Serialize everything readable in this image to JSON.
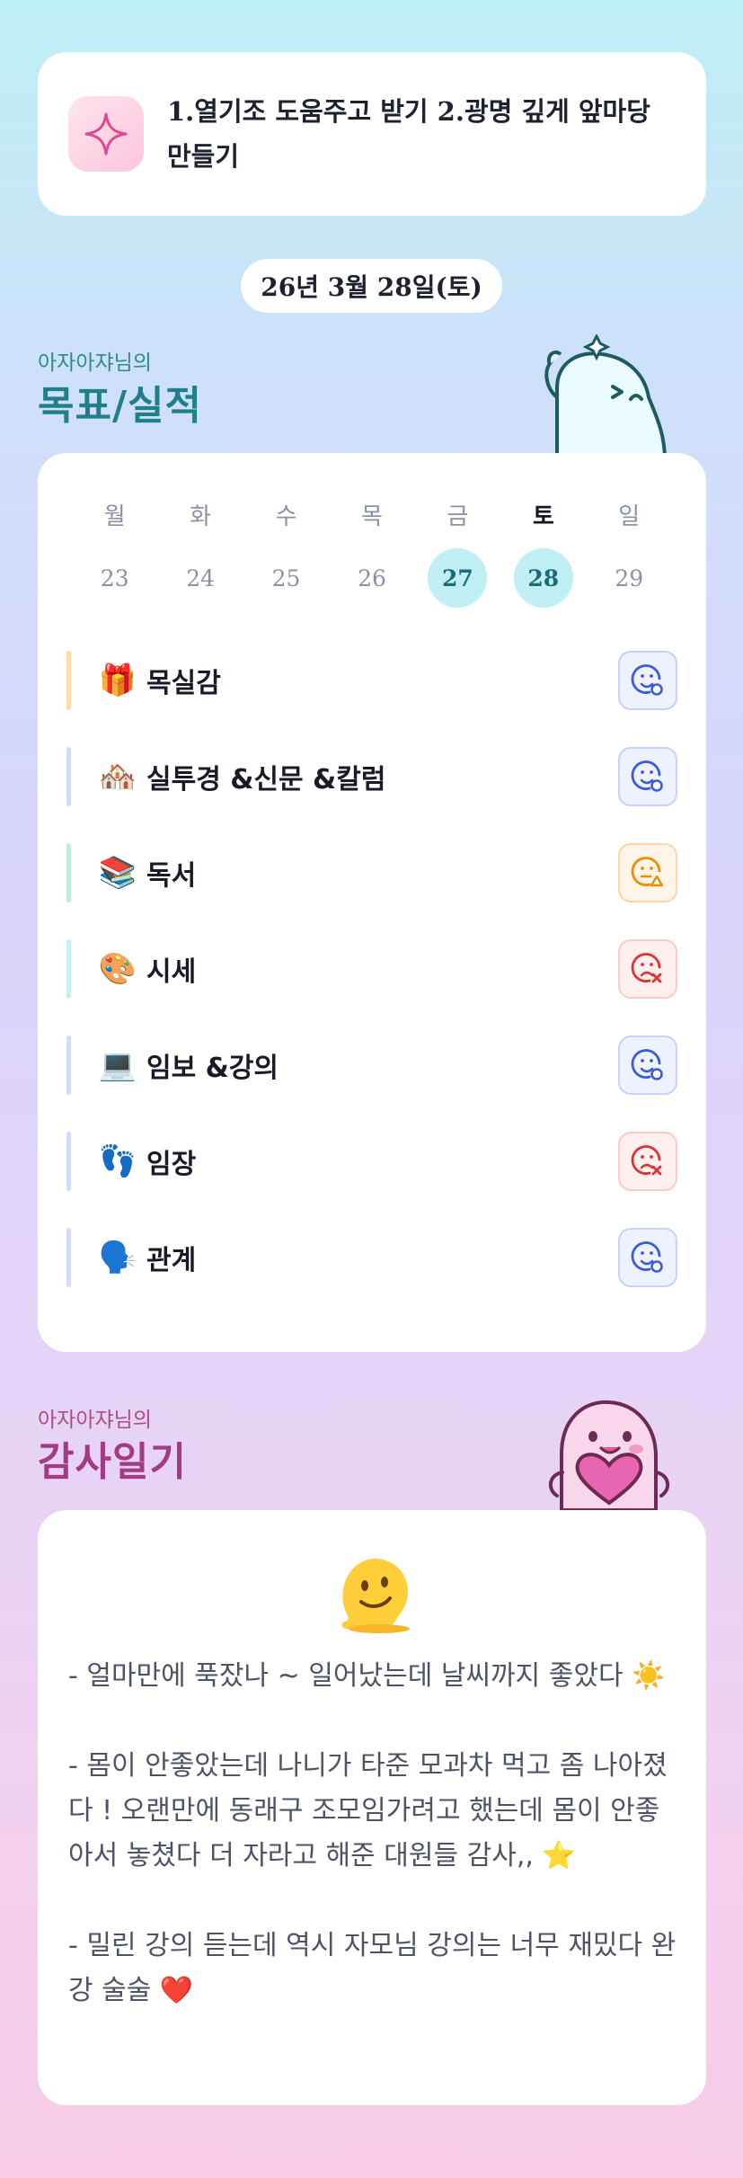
{
  "goal_banner": {
    "text": "1.열기조 도움주고 받기 2.광명 깊게 앞마당 만들기",
    "icon": "sparkle-icon"
  },
  "date_label": "26년 3월 28일(토)",
  "goals_section": {
    "subtitle": "아자아쟈님의",
    "title": "목표/실적",
    "weekdays": [
      "월",
      "화",
      "수",
      "목",
      "금",
      "토",
      "일"
    ],
    "dates": [
      "23",
      "24",
      "25",
      "26",
      "27",
      "28",
      "29"
    ],
    "highlighted_dates": [
      "27",
      "28"
    ],
    "today_weekday": "토",
    "items": [
      {
        "emoji": "🎁",
        "label": "목실감",
        "status": "done",
        "bar_color": "#ffd9a6"
      },
      {
        "emoji": "🏘️",
        "label": "실투경 &신문 &칼럼",
        "status": "done",
        "bar_color": "#d5dcfb"
      },
      {
        "emoji": "📚",
        "label": "독서",
        "status": "partial",
        "bar_color": "#bfeedd"
      },
      {
        "emoji": "🎨",
        "label": "시세",
        "status": "fail",
        "bar_color": "#c6eff2"
      },
      {
        "emoji": "💻",
        "label": "임보 &강의",
        "status": "done",
        "bar_color": "#d5dcfb"
      },
      {
        "emoji": "👣",
        "label": "임장",
        "status": "fail",
        "bar_color": "#d5dcfb"
      },
      {
        "emoji": "🗣️",
        "label": "관계",
        "status": "done",
        "bar_color": "#d5dcfb"
      }
    ]
  },
  "thanks_section": {
    "subtitle": "아자아쟈님의",
    "title": "감사일기",
    "emoji": "melting-face-icon",
    "entries_text": "- 얼마만에 푹잤나 ~ 일어났는데 날씨까지 좋았다 ☀️\n\n- 몸이 안좋았는데 나니가 타준 모과차 먹고 좀 나아졌다 ! 오랜만에 동래구 조모임가려고 했는데 몸이 안좋아서 놓쳤다 더 자라고 해준 대원들 감사,, ⭐\n\n- 밀린 강의 듣는데 역시 자모님 강의는 너무 재밌다 완강 술술 ❤️"
  },
  "colors": {
    "goals_accent": "#1f7f8a",
    "thanks_accent": "#a43a83",
    "status_done": "#3b5bdb",
    "status_partial": "#f08c00",
    "status_fail": "#e03131"
  }
}
